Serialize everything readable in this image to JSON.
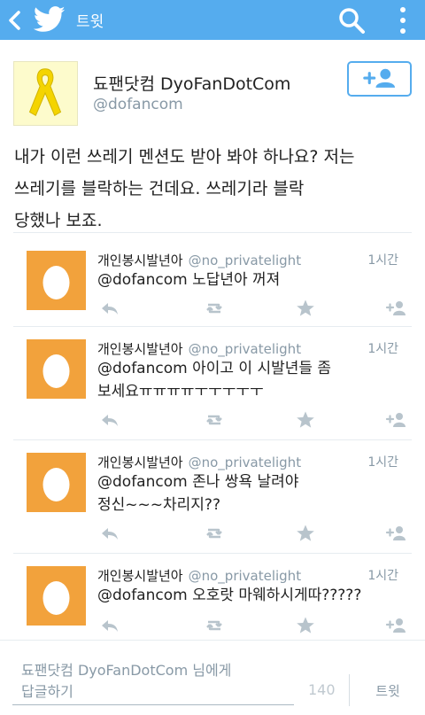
{
  "topbar": {
    "title": "트윗",
    "color": "#55acee",
    "back_icon": "chevron-left-icon",
    "logo_icon": "twitter-bird-icon",
    "search_icon": "search-icon",
    "more_icon": "overflow-menu-icon"
  },
  "tweet": {
    "author_name": "됴팬닷컴 DyoFanDotCom",
    "author_handle": "@dofancom",
    "avatar_icon": "yellow-ribbon-icon",
    "follow_icon": "add-user-icon",
    "text": "내가 이런 쓰레기 멘션도 받아 봐야 하나요? 저는\n쓰레기를 블락하는 건데요. 쓰레기라 블락\n당했나 보죠."
  },
  "replies": [
    {
      "name": "개인봉시발년아",
      "handle": "@no_privatelight",
      "time": "1시간",
      "text": "@dofancom 노답년아 꺼져"
    },
    {
      "name": "개인봉시발년아",
      "handle": "@no_privatelight",
      "time": "1시간",
      "text": "@dofancom 아이고 이 시발년들 좀\n보세요ㅠㅠㅠㅠㅜㅜㅜㅜㅜ"
    },
    {
      "name": "개인봉시발년아",
      "handle": "@no_privatelight",
      "time": "1시간",
      "text": "@dofancom 존나 쌍욕 날려야\n정신~~~차리지??"
    },
    {
      "name": "개인봉시발년아",
      "handle": "@no_privatelight",
      "time": "1시간",
      "text": "@dofancom 오호랏 마웨하시게따?????"
    }
  ],
  "composer": {
    "placeholder": "됴팬닷컴 DyoFanDotCom 님에게\n답글하기",
    "char_count": "140",
    "send_label": "트윗"
  },
  "colors": {
    "accent": "#55acee",
    "egg": "#f2a23c",
    "muted": "#8899a6"
  }
}
